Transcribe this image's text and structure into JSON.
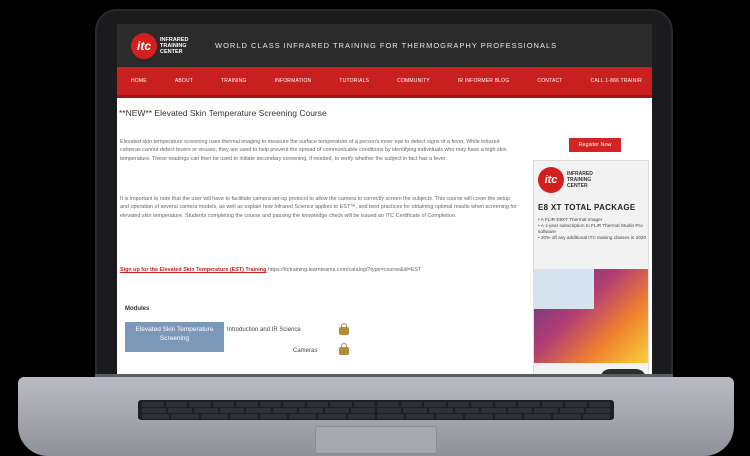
{
  "header": {
    "logo_mark": "itc",
    "logo_text": "INFRARED TRAINING CENTER",
    "tagline": "WORLD CLASS INFRARED TRAINING FOR THERMOGRAPHY PROFESSIONALS"
  },
  "nav": {
    "items": [
      "HOME",
      "ABOUT",
      "TRAINING",
      "INFORMATION",
      "TUTORIALS",
      "COMMUNITY",
      "IR INFORMER BLOG",
      "CONTACT",
      "CALL 1-866 TRAINIR"
    ]
  },
  "main": {
    "title": "**NEW** Elevated Skin Temperature Screening Course",
    "paragraph1": "Elevated skin temperature screening uses thermal imaging to measure the surface temperature of a person's inner eye to detect signs of a fever. While infrared cameras cannot detect fevers or viruses, they are used to help prevent the spread of communicable conditions by identifying individuals who may have a high skin temperature. These readings can then be used to initiate secondary screening, if needed, to verify whether the subject in fact has a fever.",
    "paragraph2": "It is important to note that the user will have to facilitate camera set-up protocol to allow the camera to correctly screen the subjects. This course will cover the setup and operation of several camera models, as well as explain how Infrared Science applies to EST™, and best practices for obtaining optimal results when screening for elevated skin temperature. Students completing the course and passing the knowledge check will be issued an ITC Certificate of Completion.",
    "signup_link": "Sign up for the Elevated Skin Temperature (EST) Training",
    "signup_url": "https://itctraining.learnteams.com/catalog/?type=course&id=EST",
    "modules_heading": "Modules",
    "course_thumb": "Elevated Skin Temperature Screening",
    "module1": "Introduction and IR Science",
    "module2": "Cameras"
  },
  "sidebar": {
    "register_label": "Register Now",
    "ad_logo": "itc",
    "ad_brand": "INFRARED TRAINING CENTER",
    "ad_title": "E8 XT TOTAL PACKAGE",
    "ad_items": [
      "A FLIR E8XT Thermal Imager",
      "A 1-year subscription to FLIR Thermal Studio Pro software",
      "20% off any additional ITC training classes in 2020"
    ]
  }
}
